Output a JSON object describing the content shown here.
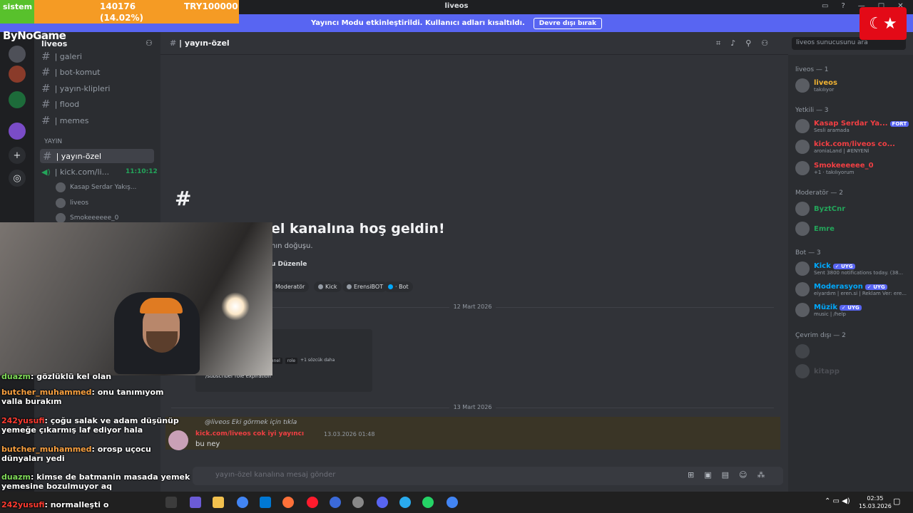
{
  "window": {
    "title": "liveos",
    "controls": [
      "▭",
      "?",
      "—",
      "□",
      "✕"
    ]
  },
  "banner": {
    "text": "Yayıncı Modu etkinleştirildi. Kullanıcı adları kısaltıldı.",
    "button": "Devre dışı bırak"
  },
  "server": {
    "name": "liveos"
  },
  "channels": [
    {
      "label": "| galeri"
    },
    {
      "label": "| bot-komut"
    },
    {
      "label": "| yayın-klipleri"
    },
    {
      "label": "| flood"
    },
    {
      "label": "| memes"
    }
  ],
  "category_yayin": "YAYIN",
  "selected_channel": {
    "label": "| yayın-özel"
  },
  "voice_channel": {
    "label": "| kick.com/li...",
    "time": "11:10:12"
  },
  "voice_users": [
    "Kasap Serdar Yakış...",
    "liveos",
    "Smokeeeeee_0"
  ],
  "header": {
    "channel": "| yayın-özel",
    "search_placeholder": "liveos sunucusunu ara"
  },
  "welcome": {
    "title": "el kanalına hoş geldin!",
    "subtitle": "nın doğuşu.",
    "edit": "u Düzenle"
  },
  "roles": [
    {
      "name": "Moderatör",
      "color": "#f0b232"
    },
    {
      "name": "Kick",
      "color": "#949ba4"
    },
    {
      "name": "ErensiBOT",
      "color": "#949ba4"
    },
    {
      "name": "· Bot",
      "color": "#00a8fc"
    }
  ],
  "dates": [
    "12 Mart 2026",
    "13 Mart 2026"
  ],
  "embed": {
    "line1": "/subscriber role expiration",
    "chips": [
      "channel",
      "role",
      "+1 sözcük daha"
    ]
  },
  "message": {
    "reply": "@liveos Eki görmek için tıkla",
    "author": "kick.com/liveos cok iyi yayıncı",
    "time": "13.03.2026 01:48",
    "text": "bu ney"
  },
  "composer": {
    "placeholder": "yayın-özel kanalına mesaj gönder"
  },
  "members": {
    "groups": [
      {
        "title": "liveos — 1",
        "items": [
          {
            "name": "liveos",
            "status": "takılıyor",
            "color": "#f0b232"
          }
        ]
      },
      {
        "title": "Yetkili — 3",
        "items": [
          {
            "name": "Kasap Serdar Ya...",
            "status": "Sesli aramada",
            "color": "#f23f43",
            "badge": "FORT"
          },
          {
            "name": "kick.com/liveos co...",
            "status": "aroniaLand | #ENYENİ",
            "color": "#f23f43"
          },
          {
            "name": "Smokeeeeee_0",
            "status": "+1 · takılıyorum",
            "color": "#f23f43"
          }
        ]
      },
      {
        "title": "Moderatör — 2",
        "items": [
          {
            "name": "ByztCnr",
            "status": "",
            "color": "#23a55a"
          },
          {
            "name": "Emre",
            "status": "",
            "color": "#23a55a"
          }
        ]
      },
      {
        "title": "Bot — 3",
        "items": [
          {
            "name": "Kick",
            "status": "Sent 3800 notifications today. (38...",
            "color": "#00a8fc",
            "badge": "✓ UYG"
          },
          {
            "name": "Moderasyon",
            "status": "eiyardım | eren.si | Reklam Ver: ere...",
            "color": "#00a8fc",
            "badge": "✓ UYG"
          },
          {
            "name": "Müzik",
            "status": "music | /help",
            "color": "#00a8fc",
            "badge": "✓ UYG"
          }
        ]
      },
      {
        "title": "Çevrim dışı — 2",
        "items": [
          {
            "name": "",
            "status": "",
            "color": "#6d6f78"
          },
          {
            "name": "kitapp",
            "status": "",
            "color": "#6d6f78"
          }
        ]
      }
    ]
  },
  "overlay": {
    "stat_label": "sistem",
    "stat_value": "140176",
    "stat_pct": "(14.02%)",
    "stat_target": "TRY100000",
    "brand": "ByNoGame"
  },
  "chat": [
    {
      "user": "duazm",
      "text": ": gözlüklü kel olan",
      "cls": "g"
    },
    {
      "user": "butcher_muhammed",
      "text": ": onu tanımıyom valla burakım",
      "cls": ""
    },
    {
      "user": "242yusufi",
      "text": ": çoğu salak ve adam düşünüp yemeğe çıkarmış laf ediyor hala",
      "cls": "r"
    },
    {
      "user": "butcher_muhammed",
      "text": ": orosp uçocu dünyaları yedi",
      "cls": ""
    },
    {
      "user": "duazm",
      "text": ": kimse de batmanin masada yemek yemesine bozulmuyor aq",
      "cls": "g"
    },
    {
      "user": "242yusufi",
      "text": ": normalleşti o",
      "cls": "r"
    }
  ],
  "clock": {
    "time": "02:35",
    "date": "15.03.2026"
  }
}
